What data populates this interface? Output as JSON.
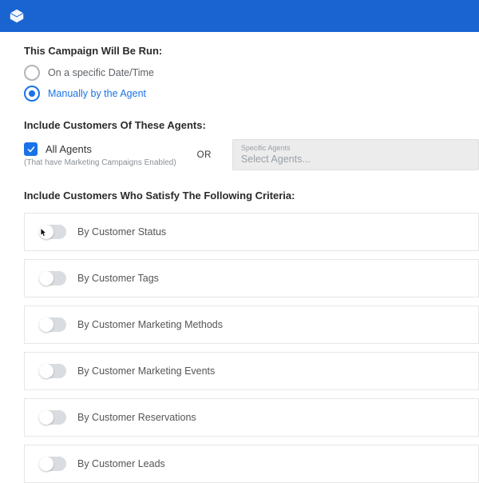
{
  "run_section": {
    "heading": "This Campaign Will Be Run:",
    "options": [
      {
        "label": "On a specific Date/Time",
        "selected": false
      },
      {
        "label": "Manually by the Agent",
        "selected": true
      }
    ]
  },
  "agents_section": {
    "heading": "Include Customers Of These Agents:",
    "checkbox_label": "All Agents",
    "checkbox_hint": "(That have Marketing Campaigns Enabled)",
    "or_label": "OR",
    "select_caption": "Specific Agents",
    "select_placeholder": "Select Agents..."
  },
  "criteria_section": {
    "heading": "Include Customers Who Satisfy The Following Criteria:",
    "items": [
      {
        "label": "By Customer Status"
      },
      {
        "label": "By Customer Tags"
      },
      {
        "label": "By Customer Marketing Methods"
      },
      {
        "label": "By Customer Marketing Events"
      },
      {
        "label": "By Customer Reservations"
      },
      {
        "label": "By Customer Leads"
      }
    ]
  }
}
